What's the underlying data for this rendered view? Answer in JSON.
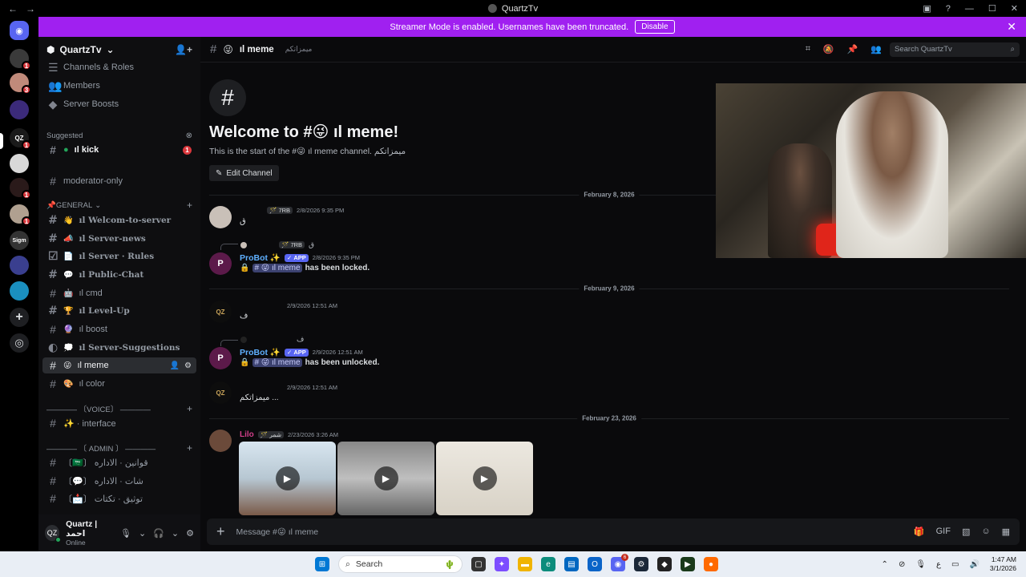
{
  "window": {
    "title": "QuartzTv",
    "back": "←",
    "forward": "→"
  },
  "banner": {
    "text": "Streamer Mode is enabled. Usernames have been truncated.",
    "button": "Disable"
  },
  "servers": [
    {
      "label": "",
      "color": "#5865f2",
      "badge": ""
    },
    {
      "label": "",
      "color": "#3a3a3a",
      "badge": "1"
    },
    {
      "label": "",
      "color": "#c08a7a",
      "badge": "3"
    },
    {
      "label": "",
      "color": "#3b2a7a",
      "badge": ""
    },
    {
      "label": "QZ",
      "color": "#1a1a1a",
      "badge": "1"
    },
    {
      "label": "",
      "color": "#d8d8d8",
      "badge": ""
    },
    {
      "label": "",
      "color": "#2a1a1a",
      "badge": "1"
    },
    {
      "label": "",
      "color": "#b0a090",
      "badge": "1"
    },
    {
      "label": "Sigm",
      "color": "#333",
      "badge": ""
    },
    {
      "label": "",
      "color": "#3a3f8f",
      "badge": ""
    },
    {
      "label": "",
      "color": "#1a8fbf",
      "badge": ""
    }
  ],
  "server": {
    "name": "QuartzTv"
  },
  "sidebar": {
    "top_items": [
      "Channels & Roles",
      "Members",
      "Server Boosts"
    ],
    "suggested_label": "Suggested",
    "suggested_channel": "ıl kick",
    "suggested_count": "1",
    "moderator": "moderator-only",
    "category_general": "GENERAL",
    "general_channels": [
      {
        "emoji": "👋",
        "name": "ıl Welcom-to-server",
        "serif": true
      },
      {
        "emoji": "📣",
        "name": "ıl Server-news",
        "serif": true
      },
      {
        "emoji": "📄",
        "name": "ıl Server · Rules",
        "serif": true
      },
      {
        "emoji": "💬",
        "name": "ıl Public-Chat",
        "serif": true
      },
      {
        "emoji": "🤖",
        "name": "ıl cmd",
        "serif": false
      },
      {
        "emoji": "🏆",
        "name": "ıl Level-Up",
        "serif": true
      },
      {
        "emoji": "🔮",
        "name": "ıl boost",
        "serif": false
      },
      {
        "emoji": "💭",
        "name": "ıl Server-Suggestions",
        "serif": true
      },
      {
        "emoji": "😜",
        "name": "ıl meme",
        "serif": false,
        "active": true
      },
      {
        "emoji": "🎨",
        "name": "ıl color",
        "serif": false
      }
    ],
    "category_voice": "———— 〔VOICE〕 ————",
    "voice_channel": "✨ · interface",
    "category_admin": "———— 〔 ADMIN 〕 ————",
    "admin_channels": [
      "〔🇸🇦〕 قوانين · الاداره",
      "〔💬〕 شات · الاداره",
      "〔📩〕 توثيق · تكتات"
    ]
  },
  "user": {
    "name": "Quartz | احمد",
    "status": "Online"
  },
  "channel": {
    "name": "ıl meme",
    "emoji": "😜",
    "topic": "ميمزاتكم",
    "search_placeholder": "Search QuartzTv"
  },
  "welcome": {
    "title": "Welcome to #😜 ıl meme!",
    "subtitle": "This is the start of the #😜 ıl meme channel. ميمزاتكم",
    "edit_button": "Edit Channel"
  },
  "messages": {
    "date1": "February 8, 2026",
    "m1_tag": "7RB",
    "m1_time": "2/8/2026 9:35 PM",
    "m1_text": "ق",
    "m2_reply_tag": "7RB",
    "m2_reply_text": "ق",
    "m2_user": "ProBot ✨",
    "app": "APP",
    "m2_time": "2/8/2026 9:35 PM",
    "m2_mention": "# 😜 ıl meme",
    "m2_text": "has been locked.",
    "date2": "February 9, 2026",
    "m3_time": "2/9/2026 12:51 AM",
    "m3_text": "ف",
    "m4_reply_text": "ف",
    "m4_user": "ProBot ✨",
    "m4_time": "2/9/2026 12:51 AM",
    "m4_mention": "# 😜 ıl meme",
    "m4_text": "has been unlocked.",
    "m5_time": "2/9/2026 12:51 AM",
    "m5_text": "ميمزاتكم ...",
    "date3": "February 23, 2026",
    "m6_user": "Lilo",
    "m6_tag": "شمر",
    "m6_time": "2/23/2026 3:26 AM"
  },
  "composer": {
    "placeholder": "Message #😜 ıl meme"
  },
  "taskbar": {
    "search": "Search",
    "time": "1:47 AM",
    "date": "3/1/2026",
    "lang": "ع",
    "discord_badge": "6"
  }
}
